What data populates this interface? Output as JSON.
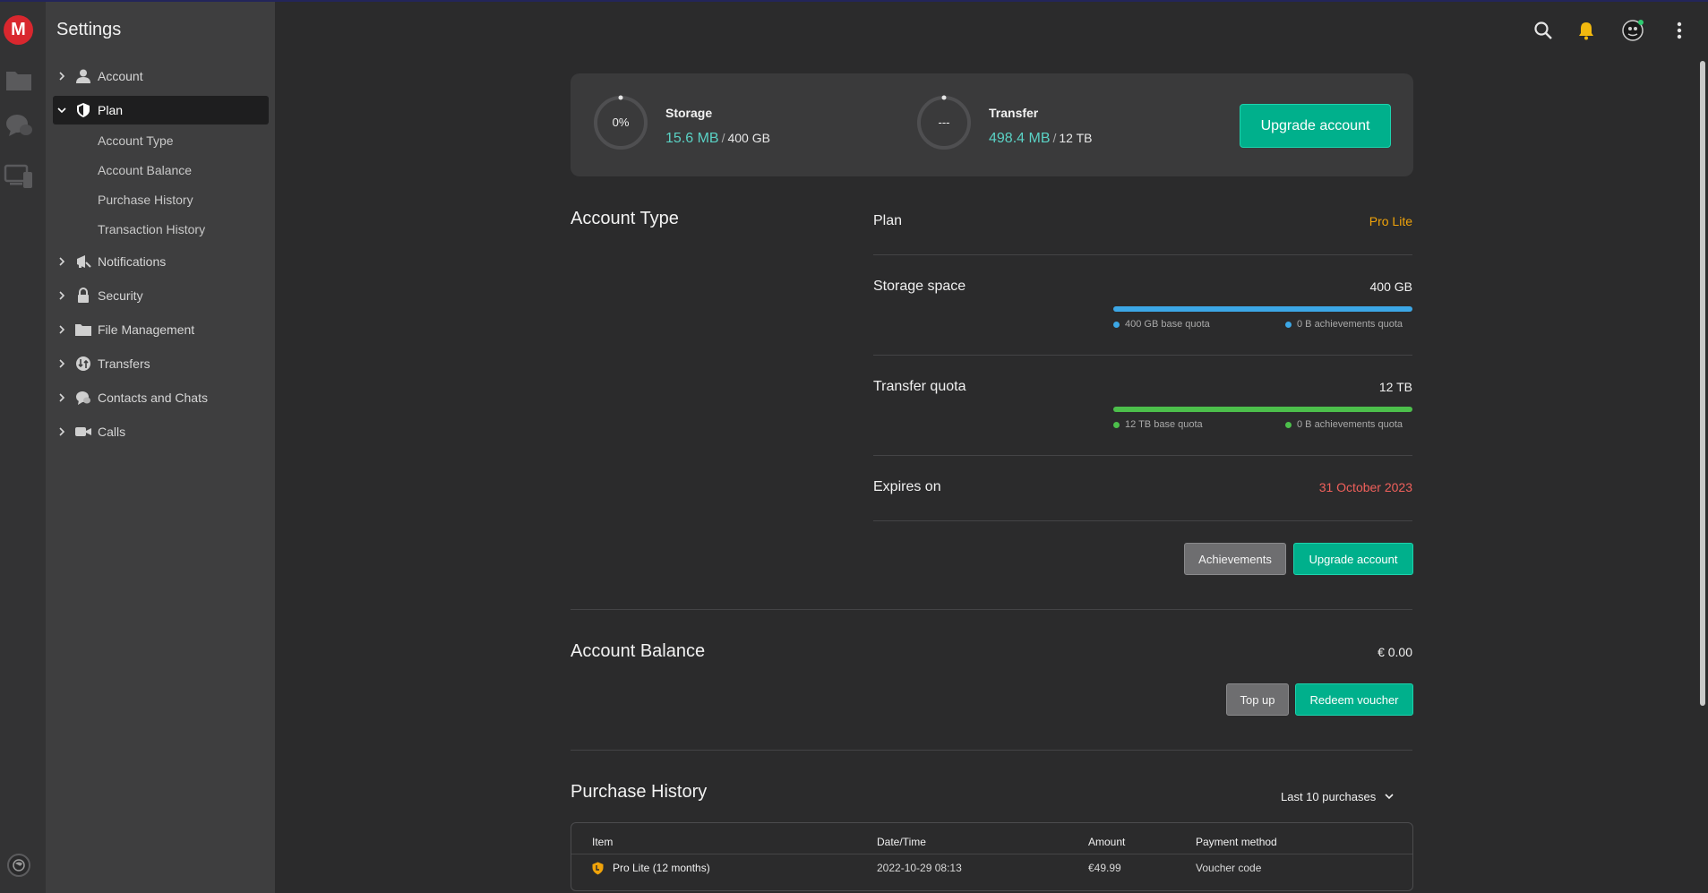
{
  "app": {
    "logo_letter": "M"
  },
  "rail": {
    "icons": [
      "cloud-drive-icon",
      "chat-icon",
      "devices-icon",
      "globe-icon"
    ]
  },
  "sidebar": {
    "title": "Settings",
    "items": [
      {
        "label": "Account",
        "icon": "user-icon"
      },
      {
        "label": "Plan",
        "icon": "shield-icon",
        "expanded": true,
        "children": [
          "Account Type",
          "Account Balance",
          "Purchase History",
          "Transaction History"
        ]
      },
      {
        "label": "Notifications",
        "icon": "megaphone-icon"
      },
      {
        "label": "Security",
        "icon": "lock-icon"
      },
      {
        "label": "File Management",
        "icon": "folder-icon"
      },
      {
        "label": "Transfers",
        "icon": "transfer-icon"
      },
      {
        "label": "Contacts and Chats",
        "icon": "chat-icon"
      },
      {
        "label": "Calls",
        "icon": "camera-icon"
      }
    ]
  },
  "topbar": {
    "icons": [
      "search-icon",
      "bell-icon",
      "avatar",
      "more-icon"
    ]
  },
  "quota": {
    "storage": {
      "percent": "0%",
      "label": "Storage",
      "used": "15.6 MB",
      "total": "400 GB"
    },
    "transfer": {
      "percent": "---",
      "label": "Transfer",
      "used": "498.4 MB",
      "total": "12 TB"
    },
    "upgrade_label": "Upgrade account"
  },
  "account_type": {
    "heading": "Account Type",
    "plan_label": "Plan",
    "plan_value": "Pro Lite",
    "storage_label": "Storage space",
    "storage_value": "400 GB",
    "storage_base": "400 GB base quota",
    "storage_ach": "0 B achievements quota",
    "storage_fill": 1.0,
    "transfer_label": "Transfer quota",
    "transfer_value": "12 TB",
    "transfer_base": "12 TB base quota",
    "transfer_ach": "0 B achievements quota",
    "transfer_fill": 1.0,
    "expires_label": "Expires on",
    "expires_value": "31 October 2023",
    "achievements_btn": "Achievements",
    "upgrade_btn": "Upgrade account"
  },
  "balance": {
    "heading": "Account Balance",
    "value": "€ 0.00",
    "topup_btn": "Top up",
    "redeem_btn": "Redeem voucher"
  },
  "purchases": {
    "heading": "Purchase History",
    "filter": "Last 10 purchases",
    "columns": [
      "Item",
      "Date/Time",
      "Amount",
      "Payment method"
    ],
    "rows": [
      {
        "item": "Pro Lite (12 months)",
        "date": "2022-10-29 08:13",
        "amount": "€49.99",
        "method": "Voucher code"
      }
    ]
  },
  "colors": {
    "accent": "#00b08c",
    "teal_text": "#5ad2c5",
    "plan_orange": "#f0a30a",
    "expiry_red": "#f0605b",
    "storage_blue": "#3ca7e6",
    "transfer_green": "#4cbf4b"
  }
}
